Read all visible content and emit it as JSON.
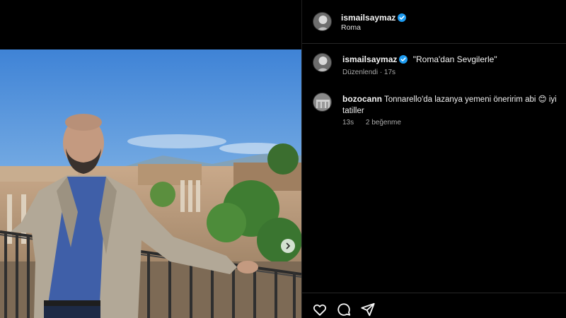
{
  "post": {
    "username": "ismailsaymaz",
    "location": "Roma"
  },
  "caption": {
    "username": "ismailsaymaz",
    "text": "\"Roma'dan Sevgilerle\"",
    "meta": "Düzenlendi · 17s"
  },
  "comments": [
    {
      "username": "bozocann",
      "text": "Tonnarello'da lazanya yemeni öneririm abi",
      "emoji": "😊",
      "text_after": "iyi tatiller",
      "time": "13s",
      "likes": "2 beğenme"
    }
  ],
  "actions": {
    "icons": [
      "heart-icon",
      "comment-icon",
      "share-icon"
    ]
  },
  "colors": {
    "background": "#000000",
    "verified_badge": "#1d9bf0",
    "secondary_text": "#a8a8a8",
    "divider": "#262626"
  }
}
